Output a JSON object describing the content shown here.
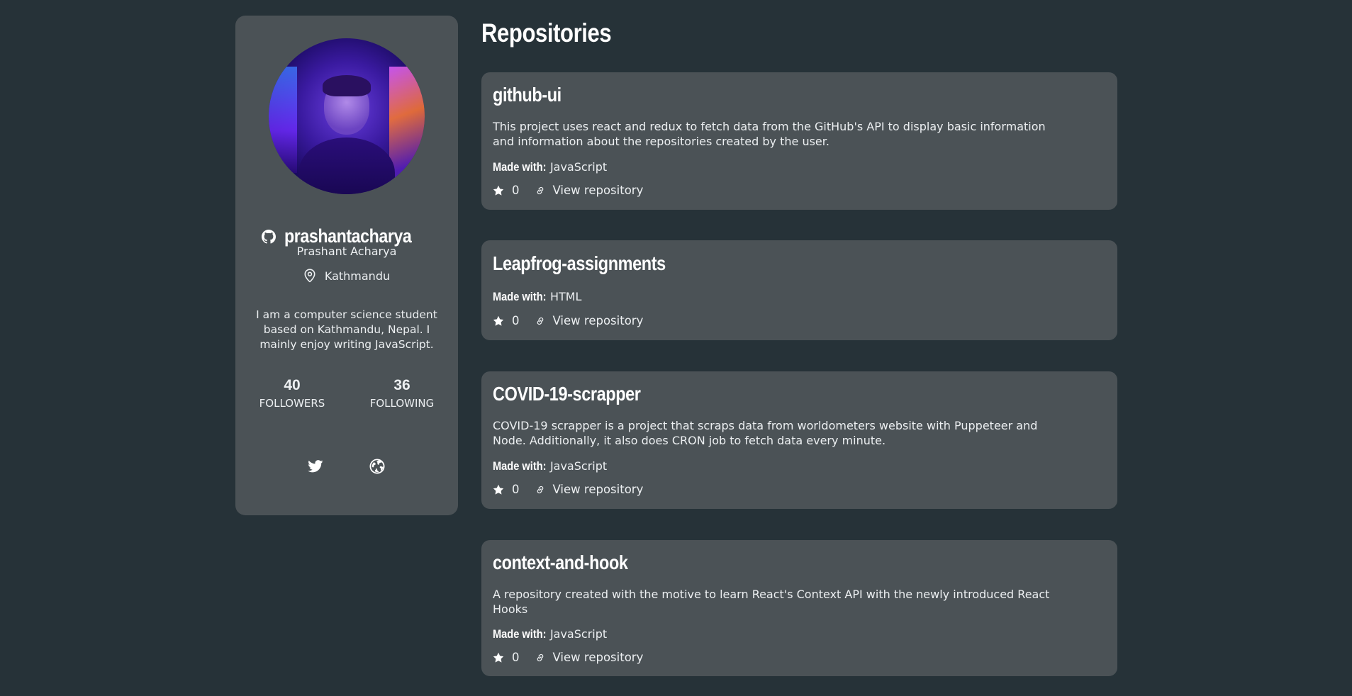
{
  "profile": {
    "username": "prashantacharya",
    "name": "Prashant Acharya",
    "location": "Kathmandu",
    "bio": "I am a computer science student based on Kathmandu, Nepal. I mainly enjoy writing JavaScript.",
    "followers_count": "40",
    "followers_label": "FOLLOWERS",
    "following_count": "36",
    "following_label": "FOLLOWING",
    "icons": {
      "github": "github-icon",
      "location": "map-pin-icon",
      "twitter": "twitter-icon",
      "website": "globe-icon"
    }
  },
  "main": {
    "title": "Repositories"
  },
  "repos": [
    {
      "name": "github-ui",
      "description": "This project uses react and redux to fetch data from the GitHub's API to display basic information and information about the repositories created by the user.",
      "made_with_label": "Made with:",
      "language": "JavaScript",
      "stars": "0",
      "link_label": "View repository"
    },
    {
      "name": "Leapfrog-assignments",
      "description": "",
      "made_with_label": "Made with:",
      "language": "HTML",
      "stars": "0",
      "link_label": "View repository"
    },
    {
      "name": "COVID-19-scrapper",
      "description": "COVID-19 scrapper is a project that scraps data from worldometers website with Puppeteer and Node. Additionally, it also does CRON job to fetch data every minute.",
      "made_with_label": "Made with:",
      "language": "JavaScript",
      "stars": "0",
      "link_label": "View repository"
    },
    {
      "name": "context-and-hook",
      "description": "A repository created with the motive to learn React's Context API with the newly introduced React Hooks",
      "made_with_label": "Made with:",
      "language": "JavaScript",
      "stars": "0",
      "link_label": "View repository"
    }
  ],
  "colors": {
    "background": "#263238",
    "card": "#4b5256",
    "text": "#eceff1"
  }
}
